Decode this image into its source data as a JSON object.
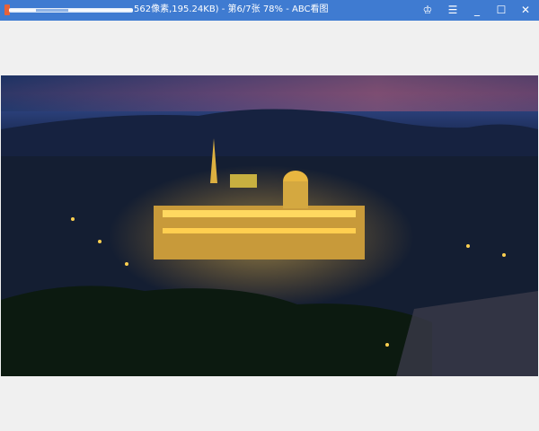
{
  "window": {
    "title": "562像素,195.24KB) - 第6/7张 78% - ABC看图",
    "loading_progress": 0.0
  },
  "controls": {
    "skin": "♔",
    "menu": "☰",
    "minimize": "_",
    "maximize": "☐",
    "close": "✕"
  },
  "colors": {
    "titlebar": "#3f7bd1",
    "background": "#f0f0f0"
  }
}
